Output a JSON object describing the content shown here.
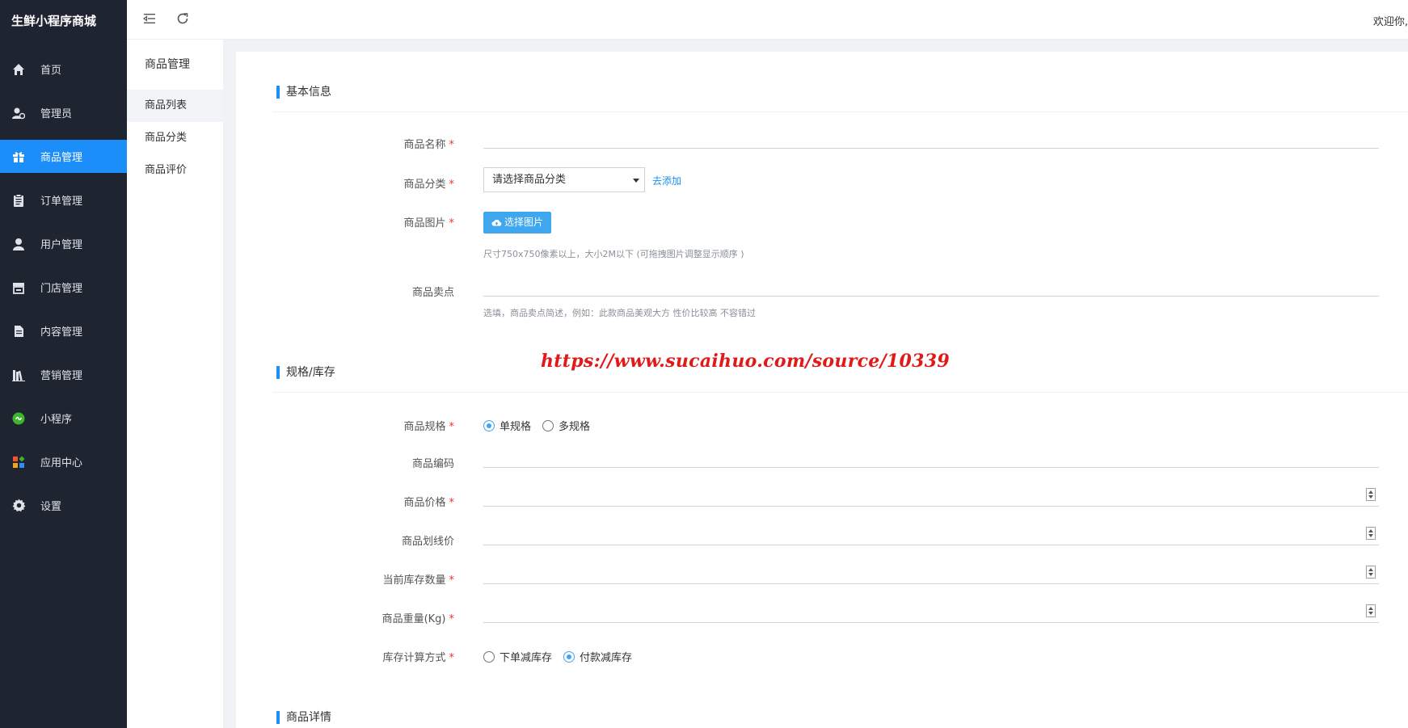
{
  "brand": "生鲜小程序商城",
  "sidebar": {
    "items": [
      {
        "label": "首页",
        "icon": "home-icon"
      },
      {
        "label": "管理员",
        "icon": "admin-user-icon"
      },
      {
        "label": "商品管理",
        "icon": "gift-icon",
        "active": true
      },
      {
        "label": "订单管理",
        "icon": "clipboard-icon"
      },
      {
        "label": "用户管理",
        "icon": "user-icon"
      },
      {
        "label": "门店管理",
        "icon": "store-icon"
      },
      {
        "label": "内容管理",
        "icon": "document-icon"
      },
      {
        "label": "营销管理",
        "icon": "books-icon"
      },
      {
        "label": "小程序",
        "icon": "mini-program-icon"
      },
      {
        "label": "应用中心",
        "icon": "apps-icon"
      },
      {
        "label": "设置",
        "icon": "gear-icon"
      }
    ]
  },
  "subnav": {
    "title": "商品管理",
    "items": [
      {
        "label": "商品列表",
        "active": true
      },
      {
        "label": "商品分类"
      },
      {
        "label": "商品评价"
      }
    ]
  },
  "topbar": {
    "welcome": "欢迎你,"
  },
  "sections": {
    "basic": "基本信息",
    "spec": "规格/库存",
    "detail": "商品详情"
  },
  "form": {
    "name_label": "商品名称",
    "category_label": "商品分类",
    "category_placeholder": "请选择商品分类",
    "category_add_link": "去添加",
    "image_label": "商品图片",
    "image_button": "选择图片",
    "image_hint": "尺寸750x750像素以上，大小2M以下 (可拖拽图片调整显示顺序 )",
    "selling_label": "商品卖点",
    "selling_hint": "选填，商品卖点简述，例如：此款商品美观大方 性价比较高 不容错过",
    "spec_label": "商品规格",
    "spec_options": [
      {
        "label": "单规格",
        "checked": true
      },
      {
        "label": "多规格",
        "checked": false
      }
    ],
    "code_label": "商品编码",
    "price_label": "商品价格",
    "line_price_label": "商品划线价",
    "stock_label": "当前库存数量",
    "weight_label": "商品重量(Kg)",
    "stock_method_label": "库存计算方式",
    "stock_method_options": [
      {
        "label": "下单减库存",
        "checked": false
      },
      {
        "label": "付款减库存",
        "checked": true
      }
    ],
    "required_mark": "*"
  },
  "watermark": "https://www.sucaihuo.com/source/10339",
  "colors": {
    "sidebar_bg": "#1f2431",
    "accent": "#1b8ef9",
    "required": "#e33333",
    "watermark": "#e01919"
  }
}
